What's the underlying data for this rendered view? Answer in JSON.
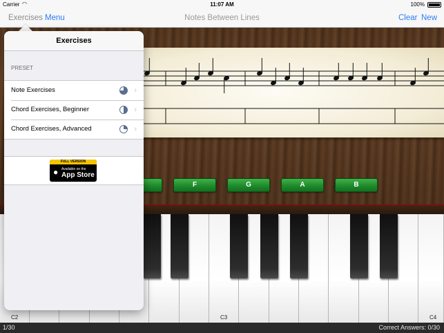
{
  "status_bar": {
    "carrier": "Carrier",
    "time": "11:07 AM",
    "battery": "100%"
  },
  "nav": {
    "exercises_label": "Exercises",
    "menu_label": "Menu",
    "title": "Notes Between Lines",
    "clear_label": "Clear",
    "new_label": "New"
  },
  "popover": {
    "title": "Exercises",
    "section": "PRESET",
    "items": [
      {
        "label": "Note Exercises",
        "progress": 0.75
      },
      {
        "label": "Chord Exercises, Beginner",
        "progress": 0.5
      },
      {
        "label": "Chord Exercises, Advanced",
        "progress": 0.25
      }
    ],
    "badge": {
      "banner": "FULL VERSION",
      "line1": "Available on the",
      "line2": "App Store"
    }
  },
  "answers": [
    "F",
    "G",
    "A",
    "B"
  ],
  "keys": {
    "labels": [
      "C2",
      "C3",
      "C4"
    ]
  },
  "bottom": {
    "progress": "1/30",
    "correct": "Correct Answers:  0/30"
  },
  "colors": {
    "accent": "#2f7cf6",
    "answer_green": "#1f8a2b",
    "wood": "#5a3a22"
  }
}
